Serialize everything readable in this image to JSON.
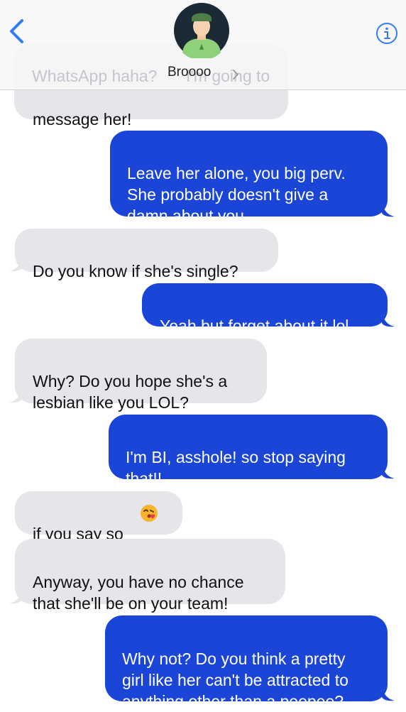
{
  "header": {
    "contact_name": "Broooo",
    "partial_message_behind_header_start": "WhatsApp haha?",
    "partial_message_behind_header_end": "I'm going to",
    "partial_message_visible": "message her!"
  },
  "messages": [
    {
      "sender": "me",
      "text": "Leave her alone, you big perv.\nShe probably doesn't give a\ndamn about you..."
    },
    {
      "sender": "contact",
      "text": "Do you know if she's single?"
    },
    {
      "sender": "me",
      "text": "Yeah but forget about it lol"
    },
    {
      "sender": "contact",
      "text": "Why? Do you hope she's a\nlesbian like you LOL?"
    },
    {
      "sender": "me",
      "text": "I'm BI, asshole! so stop saying\nthat!!"
    },
    {
      "sender": "contact",
      "text": "if you say so",
      "emoji": "face-blowing-kiss"
    },
    {
      "sender": "contact",
      "text": "Anyway, you have no chance\nthat she'll be on your team!"
    },
    {
      "sender": "me",
      "text": "Why not? Do you think a pretty\ngirl like her can't be attracted to\nanything other than a peepee?"
    }
  ],
  "colors": {
    "outgoing_bubble": "#1a45d6",
    "incoming_bubble": "#e5e5ea",
    "accent": "#2f7cf6"
  },
  "icons": {
    "back": "chevron-left-icon",
    "info": "info-icon",
    "name_chevron": "chevron-right-icon",
    "avatar": "avatar-icon"
  }
}
